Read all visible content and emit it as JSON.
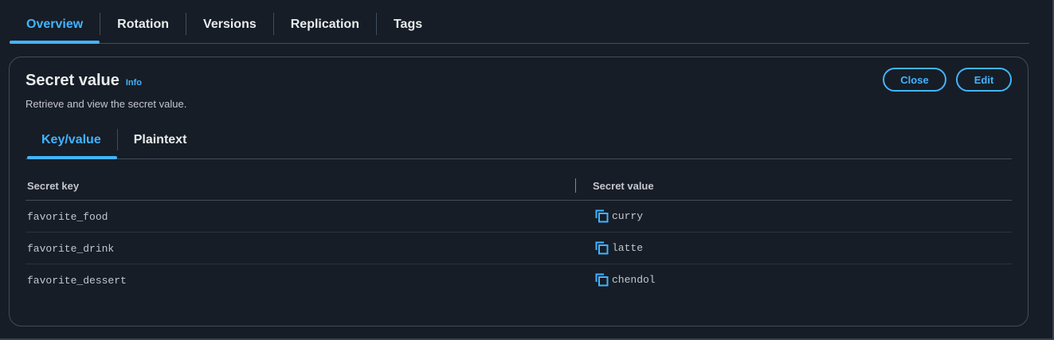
{
  "top_tabs": [
    {
      "label": "Overview",
      "active": true
    },
    {
      "label": "Rotation",
      "active": false
    },
    {
      "label": "Versions",
      "active": false
    },
    {
      "label": "Replication",
      "active": false
    },
    {
      "label": "Tags",
      "active": false
    }
  ],
  "panel": {
    "title": "Secret value",
    "info_label": "Info",
    "description": "Retrieve and view the secret value.",
    "close_label": "Close",
    "edit_label": "Edit"
  },
  "inner_tabs": [
    {
      "label": "Key/value",
      "active": true
    },
    {
      "label": "Plaintext",
      "active": false
    }
  ],
  "table": {
    "headers": {
      "key": "Secret key",
      "value": "Secret value"
    },
    "rows": [
      {
        "key": "favorite_food",
        "value": "curry"
      },
      {
        "key": "favorite_drink",
        "value": "latte"
      },
      {
        "key": "favorite_dessert",
        "value": "chendol"
      }
    ]
  },
  "colors": {
    "background": "#161d26",
    "accent": "#42b4ff",
    "border": "#414d5c",
    "text": "#e9ebed",
    "muted_text": "#c6c6cd"
  },
  "icons": {
    "copy": "copy-icon"
  }
}
